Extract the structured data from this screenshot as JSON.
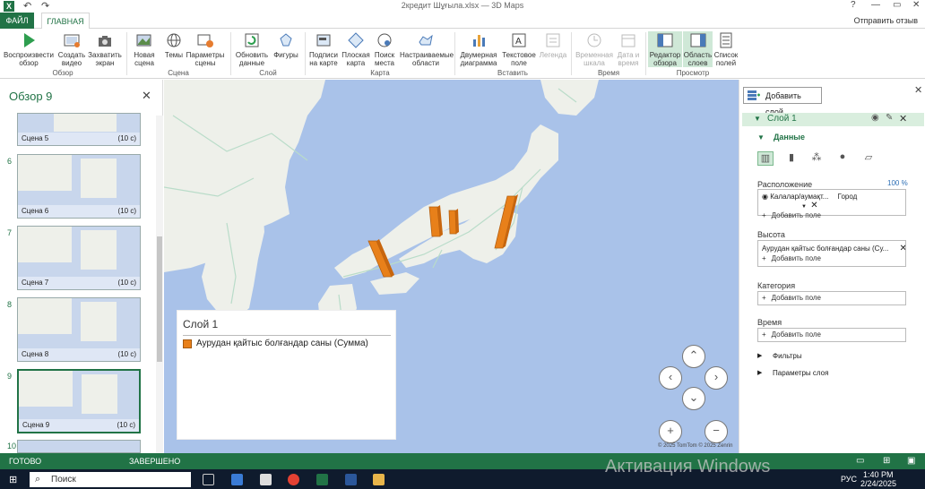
{
  "window": {
    "title": "2кредит Шұғыла.xlsx — 3D Maps",
    "help": "?",
    "restore": "▭",
    "close": "✕",
    "minimize": "—"
  },
  "quick_access": {
    "undo": "↶",
    "redo": "↷"
  },
  "tabs": {
    "file": "ФАЙЛ",
    "home": "ГЛАВНАЯ",
    "send_feedback": "Отправить отзыв"
  },
  "ribbon": {
    "play": "Воспроизвести обзор",
    "create_video": "Создать видео",
    "capture": "Захватить экран",
    "group_overview": "Обзор",
    "new_scene": "Новая сцена",
    "themes": "Темы",
    "scene_options": "Параметры сцены",
    "group_scene": "Сцена",
    "refresh": "Обновить данные",
    "shapes": "Фигуры",
    "group_layer": "Слой",
    "map_labels": "Подписи на карте",
    "flat_map": "Плоская карта",
    "find_location": "Поиск места",
    "custom_regions": "Настраиваемые области",
    "group_map": "Карта",
    "chart_2d": "Двумерная диаграмма",
    "text_box": "Текстовое поле",
    "legend": "Легенда",
    "group_insert": "Вставить",
    "timeline": "Временная шкала",
    "date_time": "Дата и время",
    "group_time": "Время",
    "tour_editor": "Редактор обзора",
    "layer_pane": "Область слоев",
    "field_list": "Список полей",
    "group_view": "Просмотр"
  },
  "tour": {
    "title": "Обзор 9",
    "scenes": [
      {
        "num": "",
        "name": "Сцена 5",
        "duration": "(10 с)"
      },
      {
        "num": "6",
        "name": "Сцена 6",
        "duration": "(10 с)"
      },
      {
        "num": "7",
        "name": "Сцена 7",
        "duration": "(10 с)"
      },
      {
        "num": "8",
        "name": "Сцена 8",
        "duration": "(10 с)"
      },
      {
        "num": "9",
        "name": "Сцена 9",
        "duration": "(10 с)"
      },
      {
        "num": "10",
        "name": "",
        "duration": ""
      }
    ]
  },
  "legend": {
    "title": "Слой 1",
    "item": "Аурудан қайтыс болғандар саны (Сумма)",
    "color": "#e8801a"
  },
  "map": {
    "copyright": "© 2025 TomTom  © 2025 Zenrin"
  },
  "layer_pane": {
    "add_layer": "Добавить слой",
    "layer_name": "Слой 1",
    "data_heading": "Данные",
    "location_label": "Расположение",
    "location_percent": "100 %",
    "location_field": "Калалар/аумақт...",
    "location_type": "Город",
    "add_field": "Добавить поле",
    "height_label": "Высота",
    "height_field": "Аурудан қайтыс болғандар саны (Су...",
    "category_label": "Категория",
    "time_label": "Время",
    "filters": "Фильтры",
    "layer_options": "Параметры слоя"
  },
  "status": {
    "ready": "ГОТОВО",
    "completed": "ЗАВЕРШЕНО"
  },
  "taskbar": {
    "search": "Поиск",
    "lang": "РУС",
    "time": "1:40 PM",
    "date": "2/24/2025"
  },
  "watermark": "Активация Windows"
}
